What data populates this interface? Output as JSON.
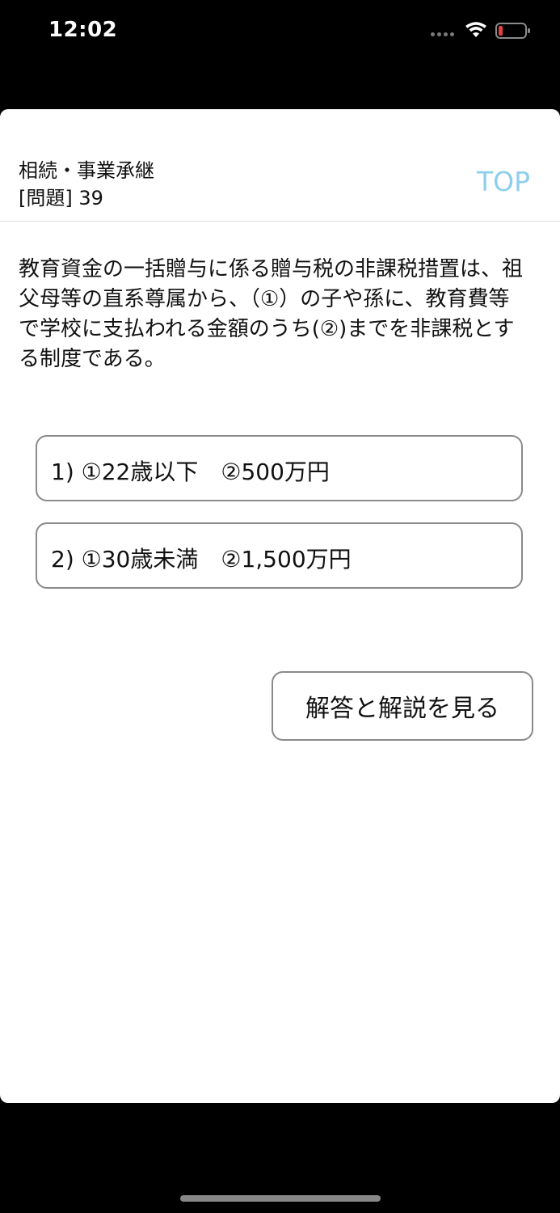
{
  "status_bar": {
    "time": "12:02"
  },
  "header": {
    "category": "相続・事業承継",
    "question_number": "[問題] 39",
    "top_link": "TOP"
  },
  "question": {
    "text": "教育資金の一括贈与に係る贈与税の非課税措置は、祖父母等の直系尊属から、（①）の子や孫に、教育費等で学校に支払われる金額のうち(②)までを非課税とする制度である。"
  },
  "choices": [
    {
      "label": "1) ①22歳以下　②500万円"
    },
    {
      "label": "2) ①30歳未満　②1,500万円"
    }
  ],
  "answer_button": {
    "label": "解答と解説を見る"
  },
  "colors": {
    "accent": "#8dcfeb",
    "border": "#8a8a8a",
    "battery_low": "#e5403b"
  }
}
